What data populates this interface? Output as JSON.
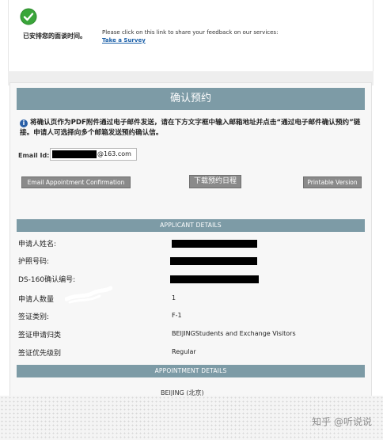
{
  "header": {
    "confirm_message": "已安排您的面谈时间。",
    "feedback_text": "Please click on this link to share your feedback on our services:",
    "survey_link": "Take a Survey"
  },
  "panel": {
    "title": "确认预约",
    "info_text": "将确认页作为PDF附件通过电子邮件发送，请在下方文字框中输入邮箱地址并点击“通过电子邮件确认预约”链接。申请人可选择向多个邮箱发送预约确认信。",
    "email_label": "Email Id:",
    "email_domain": "@163.com",
    "buttons": {
      "email_confirm": "Email Appointment Confirmation",
      "download": "下载预约日程",
      "printable": "Printable Version"
    }
  },
  "applicant_details": {
    "heading": "APPLICANT DETAILS",
    "rows": [
      {
        "label": "申请人姓名:",
        "value": ""
      },
      {
        "label": "护照号码:",
        "value": ""
      },
      {
        "label": "DS-160确认编号:",
        "value": ""
      },
      {
        "label": "申请人数量",
        "value": "1"
      },
      {
        "label": "签证类别:",
        "value": "F-1"
      },
      {
        "label": "签证申请归类",
        "value": "BEIJINGStudents and Exchange Visitors"
      },
      {
        "label": "签证优先级别",
        "value": "Regular"
      }
    ]
  },
  "appointment_details": {
    "heading": "APPOINTMENT DETAILS",
    "location": "BEIJING (北京)"
  },
  "watermark": "知乎 @听说说",
  "colors": {
    "section_bar": "#7d9ba6",
    "button_gray": "#8a8a8a",
    "link_blue": "#1a5fa8",
    "check_green": "#3aa53a"
  }
}
